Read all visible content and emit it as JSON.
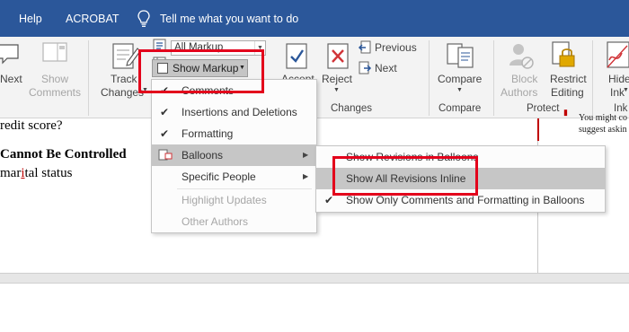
{
  "menubar": {
    "tabs": [
      "Help",
      "ACROBAT"
    ],
    "tell_me": "Tell me what you want to do"
  },
  "ribbon": {
    "comments": {
      "next": "Next",
      "show_line1": "Show",
      "show_line2": "Comments"
    },
    "tracking": {
      "track_line1": "Track",
      "track_line2": "Changes",
      "markup_dropdown": "All Markup",
      "show_markup": "Show Markup"
    },
    "changes": {
      "accept": "Accept",
      "reject": "Reject",
      "previous": "Previous",
      "next": "Next",
      "group": "Changes"
    },
    "compare": {
      "label": "Compare",
      "group": "Compare"
    },
    "protect": {
      "block_line1": "Block",
      "block_line2": "Authors",
      "restrict_line1": "Restrict",
      "restrict_line2": "Editing",
      "group": "Protect"
    },
    "ink": {
      "hide_line1": "Hide",
      "hide_line2": "Ink",
      "group": "Ink"
    }
  },
  "document": {
    "line1": "redit score?",
    "heading": "Cannot Be Controlled",
    "line3_pre": "mar",
    "line3_ins": "i",
    "line3_post": "tal status",
    "comment_line1": "You might co",
    "comment_line2": "suggest askin"
  },
  "show_markup_menu": {
    "items": [
      {
        "label": "Comments",
        "checked": true,
        "enabled": true,
        "submenu": false
      },
      {
        "label": "Insertions and Deletions",
        "checked": true,
        "enabled": true,
        "submenu": false
      },
      {
        "label": "Formatting",
        "checked": true,
        "enabled": true,
        "submenu": false
      },
      {
        "label": "Balloons",
        "checked": false,
        "enabled": true,
        "submenu": true,
        "highlighted": true
      },
      {
        "label": "Specific People",
        "checked": false,
        "enabled": true,
        "submenu": true
      },
      {
        "label": "Highlight Updates",
        "checked": false,
        "enabled": false,
        "submenu": false
      },
      {
        "label": "Other Authors",
        "checked": false,
        "enabled": false,
        "submenu": false
      }
    ]
  },
  "balloons_submenu": {
    "items": [
      {
        "label": "Show Revisions in Balloons",
        "checked": false
      },
      {
        "label": "Show All Revisions Inline",
        "checked": false,
        "highlighted": true
      },
      {
        "label": "Show Only Comments and Formatting in Balloons",
        "checked": true
      }
    ]
  },
  "colors": {
    "title_bar": "#2b579a",
    "ribbon": "#f3f3f3",
    "menu_highlight": "#c6c6c6",
    "annotation_box": "#e3001b",
    "revision_red": "#c00000"
  }
}
